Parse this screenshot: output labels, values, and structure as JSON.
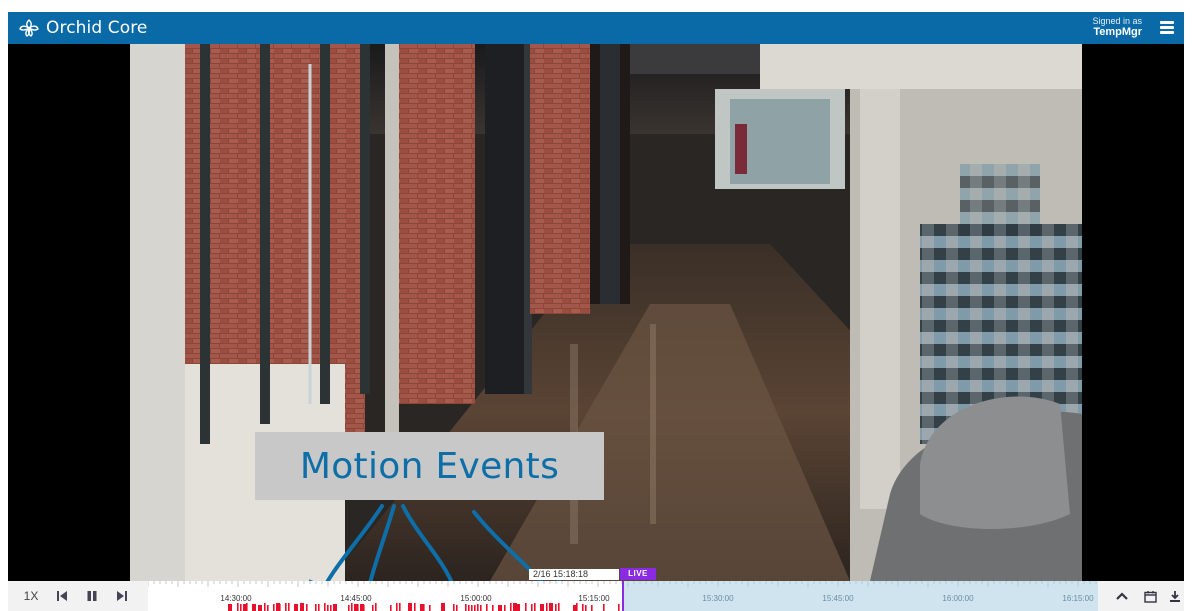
{
  "header": {
    "app_name": "Orchid Core",
    "signed_in_label": "Signed in as",
    "username": "TempMgr"
  },
  "callout": {
    "text": "Motion Events"
  },
  "playback": {
    "speed": "1X",
    "timestamp": "2/16 15:18:18",
    "live_label": "LIVE"
  },
  "timeline": {
    "labels": [
      "14:30:00",
      "14:45:00",
      "15:00:00",
      "15:15:00",
      "15:30:00",
      "15:45:00",
      "16:00:00",
      "16:15:00"
    ]
  },
  "colors": {
    "header_bg": "#0a6aa8",
    "callout_text": "#0d6ea8",
    "live_badge": "#8a2be2",
    "motion_event": "#e8112d",
    "timeline_future": "#cfe4ef"
  },
  "icons": {
    "brand": "orchid-logo-icon",
    "menu": "hamburger-icon",
    "skip_back": "skip-back-icon",
    "pause": "pause-icon",
    "skip_forward": "skip-forward-icon",
    "collapse": "chevron-up-icon",
    "calendar": "calendar-icon",
    "download": "download-icon"
  }
}
